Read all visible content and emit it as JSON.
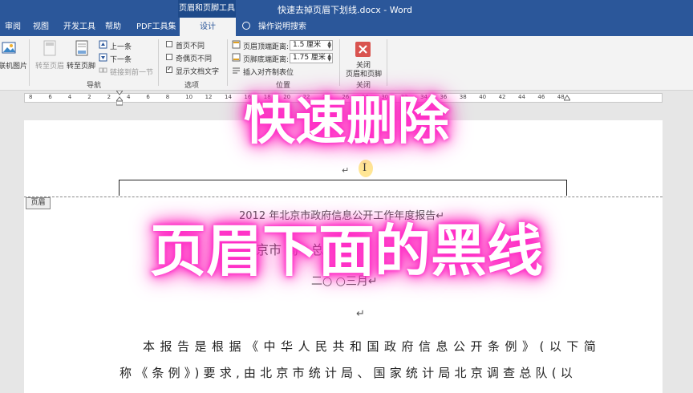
{
  "titlebar": {
    "context_tab_group": "页眉和页脚工具",
    "document_title": "快速去掉页眉下划线.docx - Word"
  },
  "tabs": [
    {
      "label": "审阅"
    },
    {
      "label": "视图"
    },
    {
      "label": "开发工具"
    },
    {
      "label": "帮助"
    },
    {
      "label": "PDF工具集"
    },
    {
      "label": "设计",
      "active": true
    }
  ],
  "tell_me": "操作说明搜索",
  "ribbon": {
    "picture_btn": "联机图片",
    "navigation": {
      "goto_header": "转至页眉",
      "goto_footer": "转至页脚",
      "previous": "上一条",
      "next": "下一条",
      "link_previous": "链接到前一节",
      "group_label": "导航"
    },
    "options": {
      "different_first": {
        "label": "首页不同",
        "checked": false
      },
      "different_odd_even": {
        "label": "奇偶页不同",
        "checked": false
      },
      "show_doc_text": {
        "label": "显示文档文字",
        "checked": true
      },
      "group_label": "选项"
    },
    "position": {
      "header_top_label": "页眉顶端距离:",
      "header_top_value": "1.5 厘米",
      "footer_bottom_label": "页脚底端距离:",
      "footer_bottom_value": "1.75 厘米",
      "insert_align_tab": "插入对齐制表位",
      "group_label": "位置"
    },
    "close": {
      "label_line1": "关闭",
      "label_line2": "页眉和页脚",
      "group_label": "关闭"
    }
  },
  "ruler": {
    "numbers": [
      "8",
      "6",
      "4",
      "2",
      "2",
      "4",
      "6",
      "8",
      "10",
      "12",
      "14",
      "16",
      "18",
      "20",
      "22",
      "24",
      "26",
      "28",
      "30",
      "32",
      "34",
      "36",
      "38",
      "40",
      "42",
      "44",
      "46",
      "48"
    ]
  },
  "document": {
    "header_tag": "页眉",
    "title_line": "2012 年北京市政府信息公开工作年度报告↵",
    "subtitle_partial": "北京市    局      ·       总",
    "date_partial": "二○    ○三月↵",
    "para_mark": "↵",
    "body_line1": "本报告是根据《中华人民共和国政府信息公开条例》(以下简",
    "body_line2": "称《条例》)要求,由北京市统计局、国家统计局北京调查总队(以"
  },
  "overlay": {
    "line1": "快速删除",
    "line2": "页眉下面的黑线"
  }
}
